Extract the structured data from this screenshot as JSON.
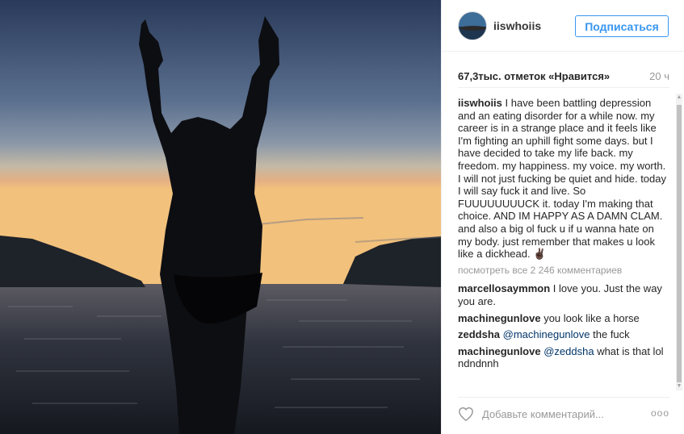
{
  "post": {
    "username": "iiswhoiis",
    "follow_label": "Подписаться",
    "likes": "67,3тыс. отметок «Нравится»",
    "time_ago": "20 ч",
    "caption_user": "iiswhoiis",
    "caption_text": "I have been battling depression and an eating disorder for a while now. my career is in a strange place and it feels like I'm fighting an uphill fight some days. but I have decided to take my life back. my freedom. my happiness. my voice. my worth. I will not just fucking be quiet and hide. today I will say fuck it and live. So FUUUUUUUUCK it. today I'm making that choice. AND IM HAPPY AS A DAMN CLAM. and also a big ol fuck u if u wanna hate on my body. just remember that makes u look like a dickhead. ✌🏿",
    "view_all": "посмотреть все 2 246 комментариев"
  },
  "comments": [
    {
      "user": "marcellosaymmon",
      "mention": "",
      "text": "I love you. Just the way you are."
    },
    {
      "user": "machinegunlove",
      "mention": "",
      "text": "you look like a horse"
    },
    {
      "user": "zeddsha",
      "mention": "@machinegunlove",
      "text": "the fuck"
    },
    {
      "user": "machinegunlove",
      "mention": "@zeddsha",
      "text": "what is that lol ndndnnh"
    }
  ],
  "footer": {
    "placeholder": "Добавьте комментарий...",
    "more": "ooo"
  },
  "icons": {
    "heart": "heart-icon",
    "more": "more-options-icon"
  },
  "colors": {
    "accent": "#3897f0",
    "mention": "#003569"
  }
}
